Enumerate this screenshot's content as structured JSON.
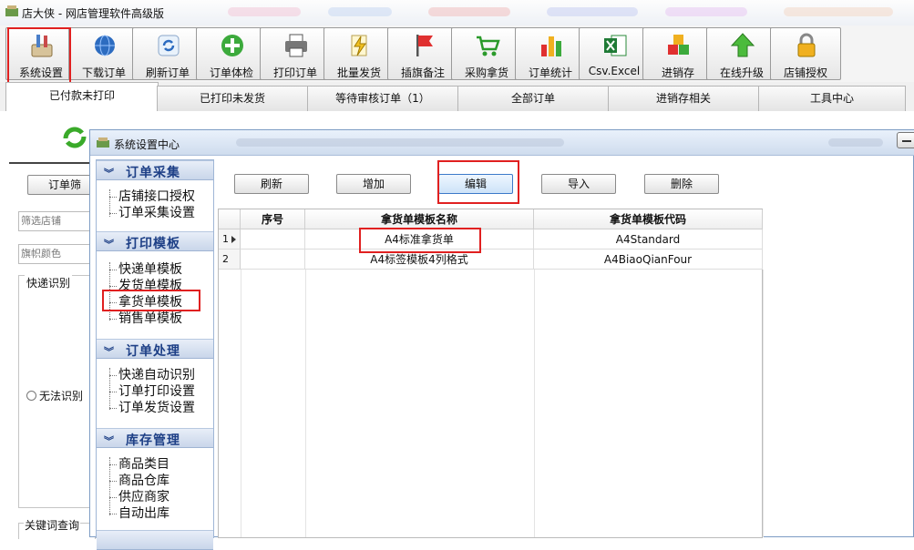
{
  "window": {
    "title": "店大侠 - 网店管理软件高级版"
  },
  "toolbar": {
    "buttons": [
      {
        "label": "系统设置",
        "icon": "settings-tools-icon"
      },
      {
        "label": "下载订单",
        "icon": "download-globe-icon"
      },
      {
        "label": "刷新订单",
        "icon": "refresh-icon"
      },
      {
        "label": "订单体检",
        "icon": "plus-circle-icon"
      },
      {
        "label": "打印订单",
        "icon": "printer-icon"
      },
      {
        "label": "批量发货",
        "icon": "lightning-doc-icon"
      },
      {
        "label": "插旗备注",
        "icon": "flag-icon"
      },
      {
        "label": "采购拿货",
        "icon": "cart-icon"
      },
      {
        "label": "订单统计",
        "icon": "bar-chart-icon"
      },
      {
        "label": "Csv.Excel",
        "icon": "excel-icon"
      },
      {
        "label": "进销存",
        "icon": "cubes-icon"
      },
      {
        "label": "在线升级",
        "icon": "up-arrow-icon"
      },
      {
        "label": "店铺授权",
        "icon": "padlock-icon"
      }
    ]
  },
  "tabs": [
    {
      "label": "已付款未打印",
      "active": true
    },
    {
      "label": "已打印未发货"
    },
    {
      "label": "等待审核订单（1）"
    },
    {
      "label": "全部订单"
    },
    {
      "label": "进销存相关"
    },
    {
      "label": "工具中心"
    }
  ],
  "left_panel": {
    "filter_button": "订单筛",
    "shop_filter": "筛选店铺",
    "flag_color": "旗帜颜色",
    "express_group": "快递识别",
    "radio_label": "无法识别",
    "keyword_query": "关键词查询"
  },
  "dialog": {
    "title": "系统设置中心",
    "sections": [
      {
        "title": "订单采集",
        "items": [
          "店铺接口授权",
          "订单采集设置"
        ]
      },
      {
        "title": "打印模板",
        "items": [
          "快递单模板",
          "发货单模板",
          "拿货单模板",
          "销售单模板"
        ]
      },
      {
        "title": "订单处理",
        "items": [
          "快递自动识别",
          "订单打印设置",
          "订单发货设置"
        ]
      },
      {
        "title": "库存管理",
        "items": [
          "商品类目",
          "商品仓库",
          "供应商家",
          "自动出库"
        ]
      }
    ],
    "buttons": {
      "refresh": "刷新",
      "add": "增加",
      "edit": "编辑",
      "import": "导入",
      "delete": "删除"
    },
    "table": {
      "columns": [
        "序号",
        "拿货单模板名称",
        "拿货单模板代码"
      ],
      "rows": [
        {
          "row": "1",
          "seq": "",
          "name": "A4标准拿货单",
          "code": "A4Standard"
        },
        {
          "row": "2",
          "seq": "",
          "name": "A4标签模板4列格式",
          "code": "A4BiaoQianFour"
        }
      ]
    }
  },
  "colors": {
    "highlight_red": "#e02020",
    "section_blue": "#1d3f86"
  }
}
